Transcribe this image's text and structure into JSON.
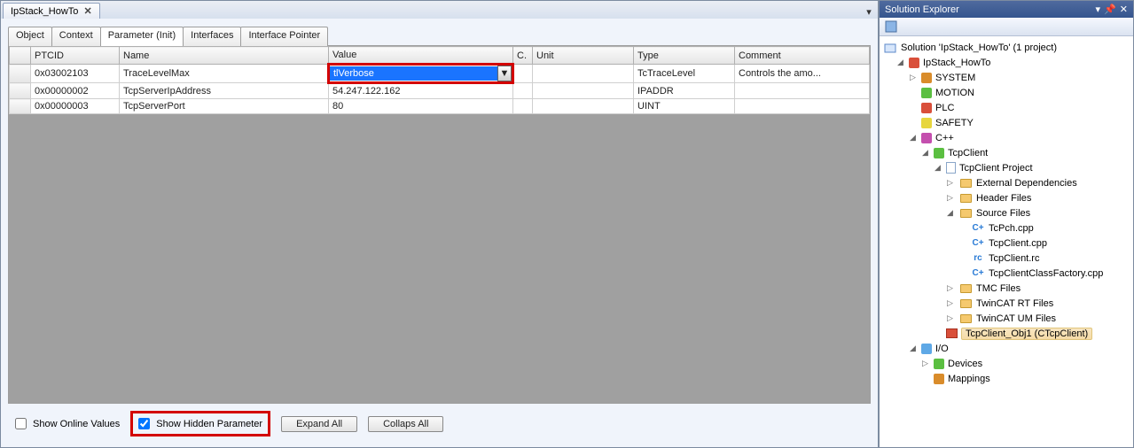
{
  "doc_tab": {
    "title": "IpStack_HowTo",
    "close": "✕",
    "dropdown": "▾"
  },
  "tabs": {
    "object": "Object",
    "context": "Context",
    "param": "Parameter (Init)",
    "interfaces": "Interfaces",
    "ifptr": "Interface Pointer"
  },
  "grid": {
    "headers": {
      "ptcid": "PTCID",
      "name": "Name",
      "value": "Value",
      "cs": "C.",
      "unit": "Unit",
      "type": "Type",
      "comment": "Comment"
    },
    "rows": [
      {
        "ptcid": "0x03002103",
        "name": "TraceLevelMax",
        "value": "tlVerbose",
        "unit": "",
        "type": "TcTraceLevel",
        "comment": "Controls the amo..."
      },
      {
        "ptcid": "0x00000002",
        "name": "TcpServerIpAddress",
        "value": "54.247.122.162",
        "unit": "",
        "type": "IPADDR",
        "comment": ""
      },
      {
        "ptcid": "0x00000003",
        "name": "TcpServerPort",
        "value": "80",
        "unit": "",
        "type": "UINT",
        "comment": ""
      }
    ]
  },
  "bottom": {
    "show_online": "Show Online Values",
    "show_hidden": "Show Hidden Parameter",
    "expand": "Expand All",
    "collapse": "Collaps All"
  },
  "explorer": {
    "title": "Solution Explorer",
    "solution": "Solution 'IpStack_HowTo' (1 project)",
    "project": "IpStack_HowTo",
    "system": "SYSTEM",
    "motion": "MOTION",
    "plc": "PLC",
    "safety": "SAFETY",
    "cpp": "C++",
    "tcpclient": "TcpClient",
    "tcpclient_proj": "TcpClient Project",
    "ext_dep": "External Dependencies",
    "header_files": "Header Files",
    "source_files": "Source Files",
    "src1": "TcPch.cpp",
    "src2": "TcpClient.cpp",
    "src3": "TcpClient.rc",
    "src4": "TcpClientClassFactory.cpp",
    "tmc": "TMC Files",
    "rt": "TwinCAT RT Files",
    "um": "TwinCAT UM Files",
    "obj1": "TcpClient_Obj1 (CTcpClient)",
    "io": "I/O",
    "devices": "Devices",
    "mappings": "Mappings"
  }
}
